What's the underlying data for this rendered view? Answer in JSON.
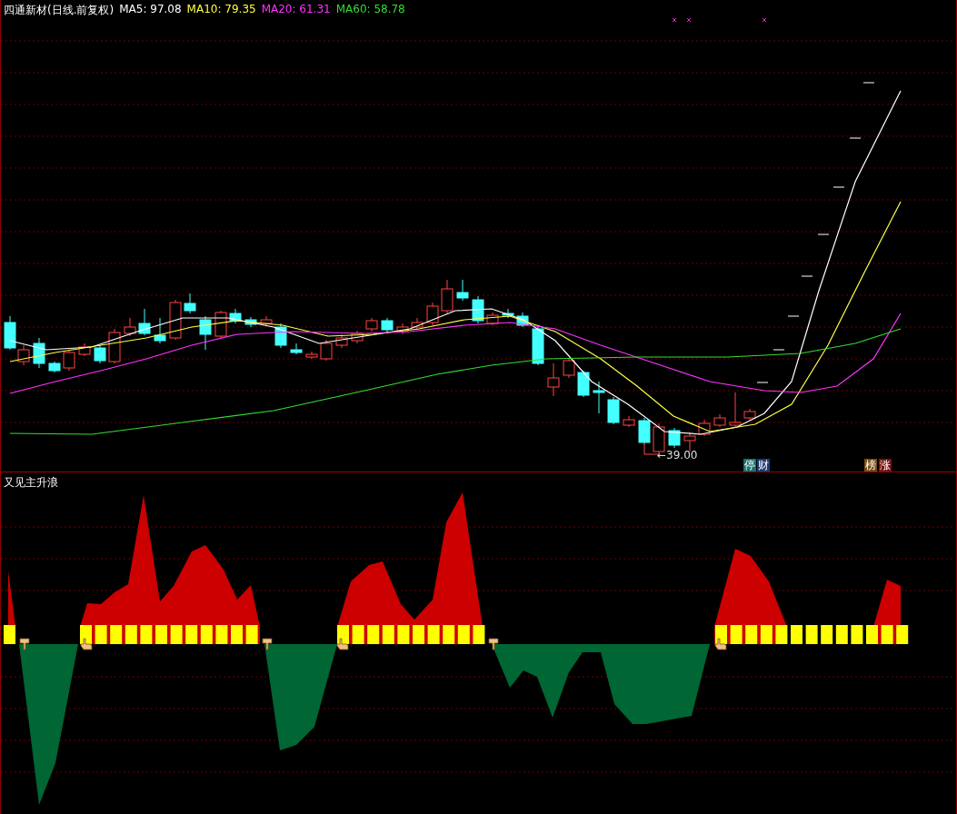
{
  "header": {
    "name": "四通新材(日线.前复权)",
    "indicators": [
      {
        "label": "MA5: 97.08",
        "color": "#ffffff"
      },
      {
        "label": "MA10: 79.35",
        "color": "#ffff44"
      },
      {
        "label": "MA20: 61.31",
        "color": "#ff33ff"
      },
      {
        "label": "MA60: 58.78",
        "color": "#33dd33"
      }
    ]
  },
  "price_chart": {
    "low_label": "←39.00",
    "event_badges": [
      {
        "text": "停",
        "color": "#1a7070"
      },
      {
        "text": "财",
        "color": "#1a3a70"
      },
      {
        "text": "榜",
        "color": "#7a4a10"
      },
      {
        "text": "涨",
        "color": "#7a1010"
      }
    ]
  },
  "indicator_pane": {
    "title": "又见主升浪"
  }
}
